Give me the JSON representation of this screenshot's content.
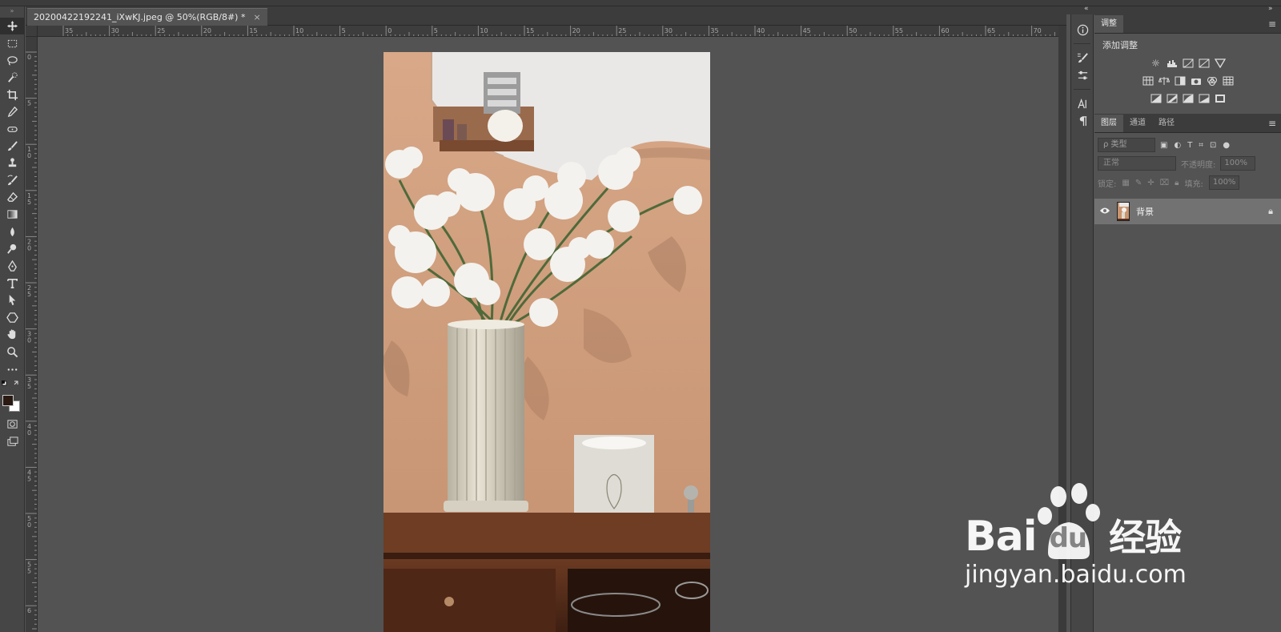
{
  "document": {
    "tab_title": "20200422192241_iXwKJ.jpeg @ 50%(RGB/8#) *",
    "close_glyph": "×"
  },
  "rulers": {
    "horizontal_labels": [
      "35",
      "30",
      "25",
      "20",
      "15",
      "10",
      "5",
      "0",
      "5",
      "10",
      "15",
      "20",
      "25",
      "30",
      "35",
      "40",
      "45",
      "50",
      "55",
      "60",
      "65",
      "70"
    ],
    "vertical_labels": [
      "0",
      "5",
      "10",
      "15",
      "20",
      "25",
      "30",
      "35",
      "40",
      "45",
      "50",
      "55",
      "6"
    ]
  },
  "tools": [
    {
      "name": "move-tool",
      "icon": "move-icon"
    },
    {
      "name": "marquee-tool",
      "icon": "marquee-icon"
    },
    {
      "name": "lasso-tool",
      "icon": "lasso-icon"
    },
    {
      "name": "quick-select-tool",
      "icon": "quick-select-icon"
    },
    {
      "name": "crop-tool",
      "icon": "crop-icon"
    },
    {
      "name": "eyedropper-tool",
      "icon": "eyedropper-icon"
    },
    {
      "name": "healing-tool",
      "icon": "healing-icon"
    },
    {
      "name": "brush-tool",
      "icon": "brush-icon"
    },
    {
      "name": "stamp-tool",
      "icon": "stamp-icon"
    },
    {
      "name": "history-brush-tool",
      "icon": "history-brush-icon"
    },
    {
      "name": "eraser-tool",
      "icon": "eraser-icon"
    },
    {
      "name": "gradient-tool",
      "icon": "gradient-icon"
    },
    {
      "name": "blur-tool",
      "icon": "blur-icon"
    },
    {
      "name": "dodge-tool",
      "icon": "dodge-icon"
    },
    {
      "name": "pen-tool",
      "icon": "pen-icon"
    },
    {
      "name": "type-tool",
      "icon": "type-icon"
    },
    {
      "name": "path-select-tool",
      "icon": "path-select-icon"
    },
    {
      "name": "shape-tool",
      "icon": "shape-icon"
    },
    {
      "name": "hand-tool",
      "icon": "hand-icon"
    },
    {
      "name": "zoom-tool",
      "icon": "zoom-icon"
    },
    {
      "name": "more-tools",
      "icon": "ellipsis-icon"
    }
  ],
  "colors": {
    "foreground": "#2a1a12",
    "background": "#ffffff",
    "chrome_dark": "#3c3c3c",
    "panel": "#535353",
    "layer_selected": "#727272"
  },
  "adjustments_panel": {
    "tab_label": "调整",
    "title": "添加调整",
    "row1": [
      "brightness-icon",
      "levels-icon",
      "curves-icon",
      "exposure-icon",
      "vibrance-icon"
    ],
    "row2": [
      "hue-sat-icon",
      "color-balance-icon",
      "bw-icon",
      "photo-filter-icon",
      "channel-mixer-icon",
      "color-lookup-icon"
    ],
    "row3": [
      "invert-icon",
      "posterize-icon",
      "threshold-icon",
      "gradient-map-icon",
      "selective-color-icon"
    ]
  },
  "layers_panel": {
    "tabs": [
      "图层",
      "通道",
      "路径"
    ],
    "kind_filter": "ρ 类型",
    "blend_mode": "正常",
    "opacity_label": "不透明度:",
    "opacity_value": "100%",
    "lock_label": "锁定:",
    "fill_label": "填充:",
    "fill_value": "100%",
    "layers": [
      {
        "name": "背景",
        "visible": true,
        "locked": true
      }
    ]
  },
  "watermark": {
    "brand_text": "Bai",
    "brand_du": "du",
    "brand_cn": "经验",
    "url": "jingyan.baidu.com"
  }
}
